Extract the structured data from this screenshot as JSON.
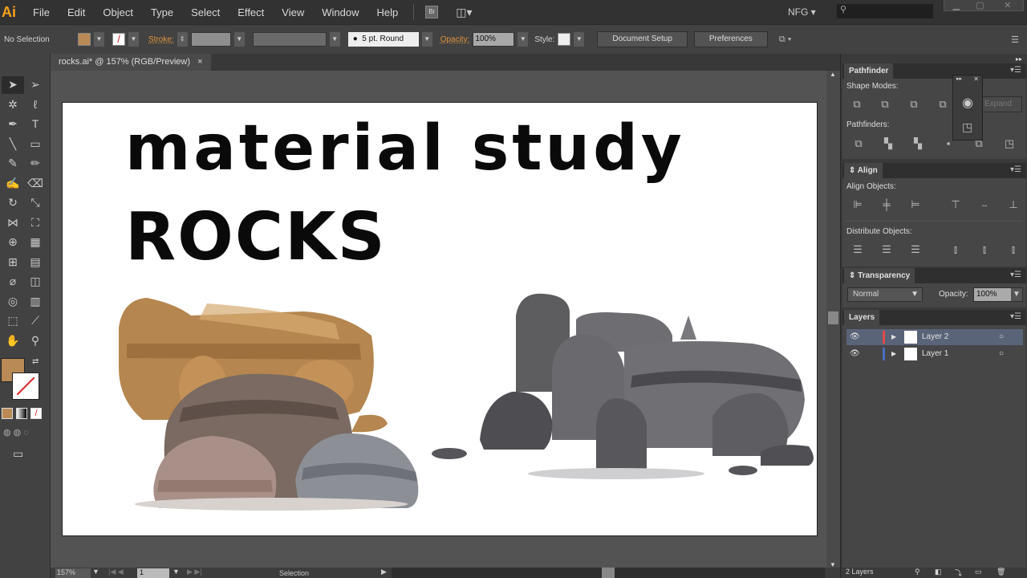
{
  "app": {
    "logo": "Ai",
    "bridge": "Br",
    "workspace": "NFG",
    "search_placeholder": ""
  },
  "menu": [
    "File",
    "Edit",
    "Object",
    "Type",
    "Select",
    "Effect",
    "View",
    "Window",
    "Help"
  ],
  "control": {
    "selection": "No Selection",
    "fill_color": "#b98a55",
    "stroke_label": "Stroke:",
    "brush": "5 pt. Round",
    "opacity_label": "Opacity:",
    "opacity": "100%",
    "style_label": "Style:",
    "document_setup": "Document Setup",
    "preferences": "Preferences"
  },
  "document": {
    "tab": "rocks.ai* @ 157% (RGB/Preview)",
    "close": "×",
    "heading1": "material study",
    "heading2": "ROCKS"
  },
  "status": {
    "zoom": "157%",
    "page": "1",
    "tool": "Selection"
  },
  "tools": [
    {
      "name": "selection-tool",
      "glyph": "➤"
    },
    {
      "name": "direct-selection-tool",
      "glyph": "➢"
    },
    {
      "name": "magic-wand-tool",
      "glyph": "✲"
    },
    {
      "name": "lasso-tool",
      "glyph": "ℓ"
    },
    {
      "name": "pen-tool",
      "glyph": "✒"
    },
    {
      "name": "type-tool",
      "glyph": "T"
    },
    {
      "name": "line-tool",
      "glyph": "╲"
    },
    {
      "name": "rectangle-tool",
      "glyph": "▭"
    },
    {
      "name": "paintbrush-tool",
      "glyph": "✎"
    },
    {
      "name": "pencil-tool",
      "glyph": "✏"
    },
    {
      "name": "blob-brush-tool",
      "glyph": "✍"
    },
    {
      "name": "eraser-tool",
      "glyph": "⌫"
    },
    {
      "name": "rotate-tool",
      "glyph": "↻"
    },
    {
      "name": "scale-tool",
      "glyph": "⤡"
    },
    {
      "name": "width-tool",
      "glyph": "⋈"
    },
    {
      "name": "free-transform-tool",
      "glyph": "⛶"
    },
    {
      "name": "shape-builder-tool",
      "glyph": "⊕"
    },
    {
      "name": "perspective-grid-tool",
      "glyph": "▦"
    },
    {
      "name": "mesh-tool",
      "glyph": "⊞"
    },
    {
      "name": "gradient-tool",
      "glyph": "▤"
    },
    {
      "name": "eyedropper-tool",
      "glyph": "⌀"
    },
    {
      "name": "blend-tool",
      "glyph": "◫"
    },
    {
      "name": "symbol-sprayer-tool",
      "glyph": "◎"
    },
    {
      "name": "column-graph-tool",
      "glyph": "▥"
    },
    {
      "name": "artboard-tool",
      "glyph": "⬚"
    },
    {
      "name": "slice-tool",
      "glyph": "⟋"
    },
    {
      "name": "hand-tool",
      "glyph": "✋"
    },
    {
      "name": "zoom-tool",
      "glyph": "⚲"
    }
  ],
  "panels": {
    "pathfinder": {
      "title": "Pathfinder",
      "shape_modes": "Shape Modes:",
      "pathfinders": "Pathfinders:",
      "expand": "Expand"
    },
    "align": {
      "title": "Align",
      "align_objects": "Align Objects:",
      "distribute_objects": "Distribute Objects:"
    },
    "transparency": {
      "title": "Transparency",
      "blend_mode": "Normal",
      "opacity_label": "Opacity:",
      "opacity": "100%"
    },
    "layers": {
      "title": "Layers",
      "items": [
        {
          "name": "Layer 2",
          "color": "#e04a4a"
        },
        {
          "name": "Layer 1",
          "color": "#4a6fc0"
        }
      ],
      "count": "2 Layers"
    }
  }
}
